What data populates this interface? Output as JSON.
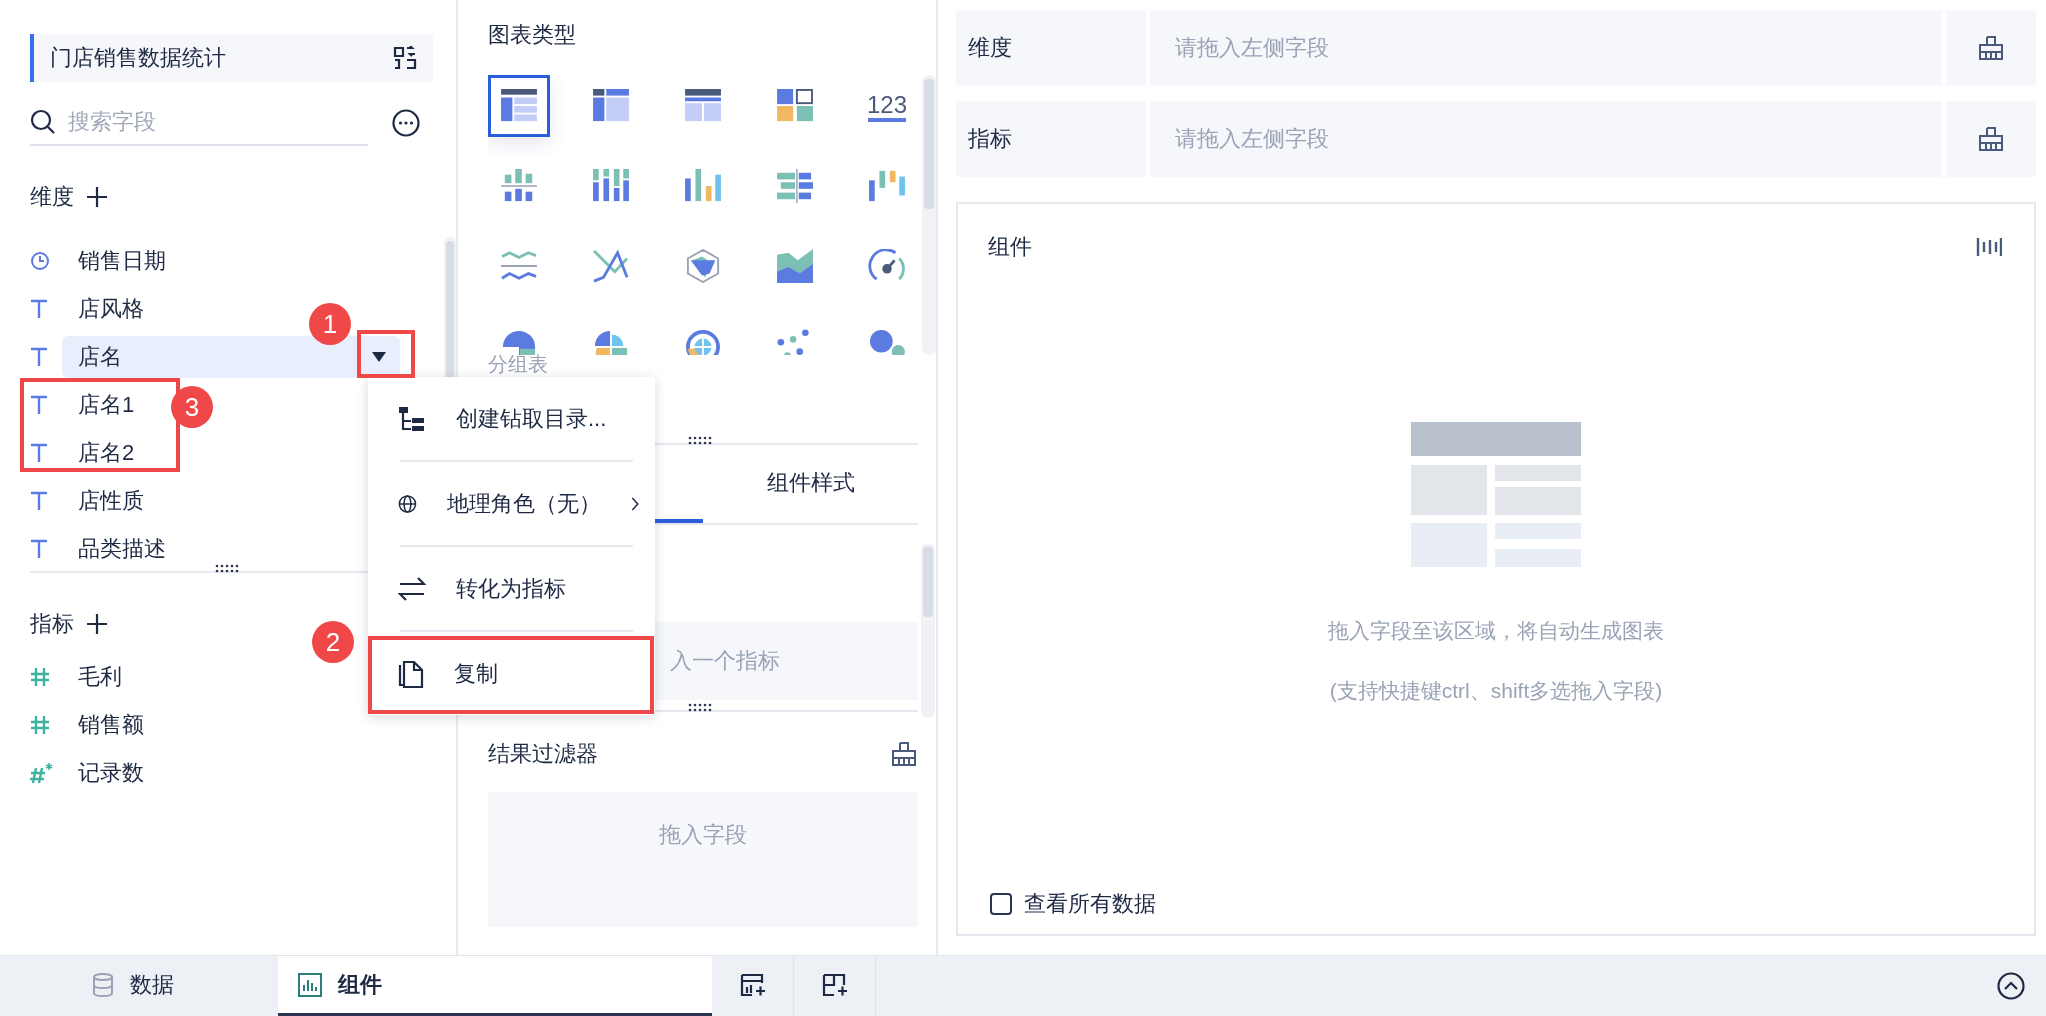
{
  "dataset": {
    "title": "门店销售数据统计"
  },
  "search": {
    "placeholder": "搜索字段"
  },
  "dimension_section": {
    "title": "维度"
  },
  "dimension_fields": [
    {
      "name": "销售日期",
      "kind": "date",
      "selected": false
    },
    {
      "name": "店风格",
      "kind": "text",
      "selected": false
    },
    {
      "name": "店名",
      "kind": "text",
      "selected": true
    },
    {
      "name": "店名1",
      "kind": "text",
      "selected": false
    },
    {
      "name": "店名2",
      "kind": "text",
      "selected": false
    },
    {
      "name": "店性质",
      "kind": "text",
      "selected": false
    },
    {
      "name": "品类描述",
      "kind": "text",
      "selected": false
    }
  ],
  "measure_section": {
    "title": "指标"
  },
  "measure_fields": [
    {
      "name": "毛利",
      "kind": "number",
      "selected": false
    },
    {
      "name": "销售额",
      "kind": "number",
      "selected": false
    },
    {
      "name": "记录数",
      "kind": "count",
      "selected": false
    }
  ],
  "chart_panel": {
    "title": "图表类型",
    "hover_label": "分组表",
    "types": [
      {
        "kind": "group-table",
        "selected": true
      },
      {
        "kind": "cross-table",
        "selected": false
      },
      {
        "kind": "detail-table",
        "selected": false
      },
      {
        "kind": "kpi",
        "selected": false
      },
      {
        "kind": "number",
        "label": "123",
        "selected": false
      },
      {
        "kind": "split-bar",
        "selected": false
      },
      {
        "kind": "stacked-bar",
        "selected": false
      },
      {
        "kind": "multi-bar",
        "selected": false
      },
      {
        "kind": "diverging-bar",
        "selected": false
      },
      {
        "kind": "waterfall",
        "selected": false
      },
      {
        "kind": "split-line",
        "selected": false
      },
      {
        "kind": "line",
        "selected": false
      },
      {
        "kind": "radar",
        "selected": false
      },
      {
        "kind": "area",
        "selected": false
      },
      {
        "kind": "gauge",
        "selected": false
      },
      {
        "kind": "pie",
        "selected": false
      },
      {
        "kind": "rose",
        "selected": false
      },
      {
        "kind": "sunburst",
        "selected": false
      },
      {
        "kind": "scatter",
        "selected": false
      },
      {
        "kind": "bubble",
        "selected": false
      }
    ]
  },
  "config_tabs": [
    {
      "selected": true
    },
    {
      "label": "组件样式",
      "selected": false
    }
  ],
  "measure_drop": {
    "hint": "入一个指标"
  },
  "result_filter": {
    "title": "结果过滤器",
    "hint": "拖入字段"
  },
  "shelves": [
    {
      "label": "维度",
      "hint": "请拖入左侧字段"
    },
    {
      "label": "指标",
      "hint": "请拖入左侧字段"
    }
  ],
  "component": {
    "title": "组件",
    "hint": "拖入字段至该区域，将自动生成图表",
    "subhint": "(支持快捷键ctrl、shift多选拖入字段)",
    "show_all": {
      "label": "查看所有数据",
      "checked": false
    }
  },
  "bottom_tabs": [
    {
      "label": "数据",
      "kind": "data",
      "selected": false
    },
    {
      "label": "组件",
      "kind": "component",
      "selected": true
    }
  ],
  "context_menu": {
    "items": [
      {
        "label": "创建钻取目录...",
        "kind": "drill",
        "submenu": false
      },
      {
        "label": "地理角色（无）",
        "kind": "geo",
        "submenu": true
      },
      {
        "label": "转化为指标",
        "kind": "convert",
        "submenu": false
      },
      {
        "label": "复制",
        "kind": "copy",
        "submenu": false
      }
    ]
  },
  "annotations": [
    {
      "label": "1"
    },
    {
      "label": "2"
    },
    {
      "label": "3"
    }
  ]
}
